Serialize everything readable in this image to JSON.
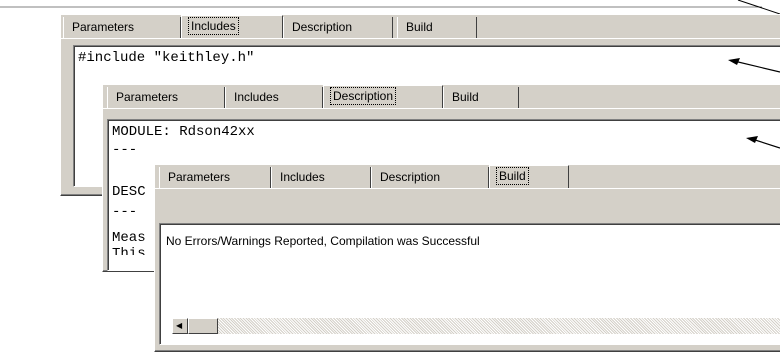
{
  "window1": {
    "tabs": [
      "Parameters",
      "Includes",
      "Description",
      "Build"
    ],
    "active_tab": "Includes",
    "content_line": "#include \"keithley.h\""
  },
  "window2": {
    "tabs": [
      "Parameters",
      "Includes",
      "Description",
      "Build"
    ],
    "active_tab": "Description",
    "lines": [
      "MODULE: Rdson42xx",
      "---",
      "",
      "DESC",
      "---",
      "Meas",
      "This"
    ]
  },
  "window3": {
    "tabs": [
      "Parameters",
      "Includes",
      "Description",
      "Build"
    ],
    "active_tab": "Build",
    "message": "No Errors/Warnings Reported, Compilation was Successful"
  },
  "scrollbar": {
    "left_arrow": "◀"
  },
  "colors": {
    "face": "#d4d0c8",
    "highlight": "#ffffff",
    "shadow": "#808080",
    "dark_shadow": "#404040"
  }
}
